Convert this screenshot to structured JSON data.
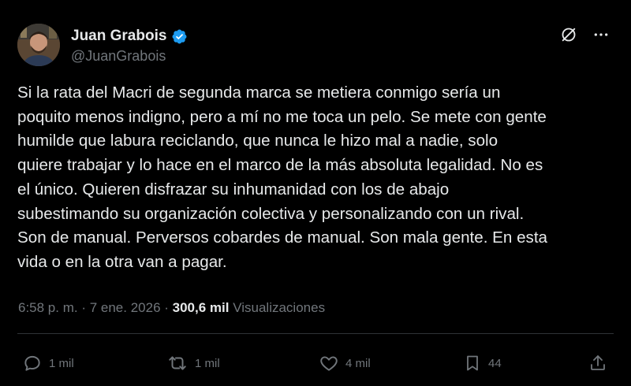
{
  "author": {
    "display_name": "Juan Grabois",
    "handle": "@JuanGrabois",
    "verified_color": "#1d9bf0"
  },
  "post": {
    "text": "Si la rata del Macri de segunda marca se metiera conmigo sería un\npoquito menos indigno, pero a mí no me toca un pelo. Se mete con gente\nhumilde que labura reciclando, que nunca le hizo mal a nadie, solo\nquiere trabajar y lo hace en el marco de la más absoluta legalidad. No es\nel único. Quieren disfrazar su inhumanidad con los de abajo\nsubestimando su organización colectiva y personalizando con un rival.\nSon de manual. Perversos cobardes de manual. Son mala gente. En esta\nvida o en la otra van a pagar.",
    "time": "6:58 p. m.",
    "separator": " · ",
    "date": "7 ene. 2026",
    "views_count": "300,6 mil",
    "views_label": "Visualizaciones"
  },
  "actions": {
    "replies": "1 mil",
    "reposts": "1 mil",
    "likes": "4 mil",
    "bookmarks": "44"
  },
  "icons": {
    "grok": "grok-icon",
    "more": "more-icon",
    "reply": "reply-icon",
    "repost": "repost-icon",
    "like": "heart-icon",
    "bookmark": "bookmark-icon",
    "share": "share-icon"
  },
  "colors": {
    "background": "#000000",
    "text": "#e7e9ea",
    "secondary": "#71767b",
    "divider": "#2f3336"
  }
}
